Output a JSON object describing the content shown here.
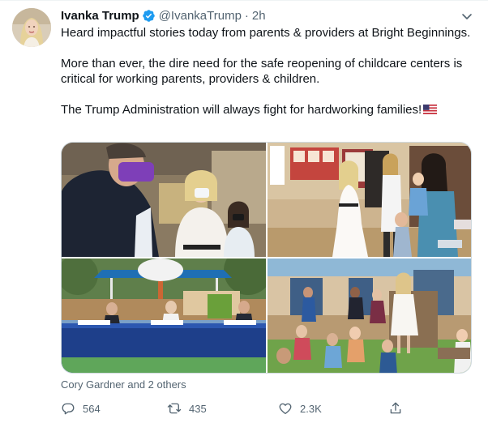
{
  "tweet": {
    "author_name": "Ivanka Trump",
    "author_handle": "@IvankaTrump",
    "separator": "·",
    "time": "2h",
    "text_lines": [
      "Heard impactful stories today from parents & providers at Bright Beginnings.",
      "More than ever, the dire need for the safe reopening of childcare centers is critical for working parents, providers & children.",
      "The Trump Administration will always fight for hardworking families!"
    ],
    "flag_icon": "us-flag-emoji",
    "tagged_people": "Cory Gardner and 2 others"
  },
  "metrics": {
    "replies": "564",
    "retweets": "435",
    "likes": "2.3K"
  },
  "colors": {
    "text_primary": "#0f1419",
    "text_secondary": "#536471",
    "verified_blue": "#1d9bf0",
    "border": "#cfd9de"
  },
  "icons": {
    "verified": "verified-badge-icon",
    "more": "chevron-down-icon",
    "reply": "reply-icon",
    "retweet": "retweet-icon",
    "like": "heart-icon",
    "share": "share-icon"
  }
}
